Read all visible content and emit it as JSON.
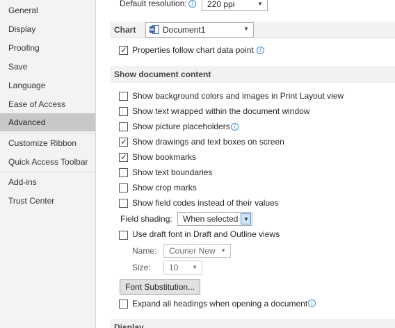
{
  "sidebar": {
    "items": [
      {
        "label": "General"
      },
      {
        "label": "Display"
      },
      {
        "label": "Proofing"
      },
      {
        "label": "Save"
      },
      {
        "label": "Language"
      },
      {
        "label": "Ease of Access"
      },
      {
        "label": "Advanced",
        "active": true
      },
      {
        "label": "Customize Ribbon"
      },
      {
        "label": "Quick Access Toolbar"
      },
      {
        "label": "Add-ins"
      },
      {
        "label": "Trust Center"
      }
    ]
  },
  "image_size": {
    "label": "Default resolution:",
    "value": "220 ppi"
  },
  "chart": {
    "title": "Chart",
    "document": "Document1",
    "properties_follow": {
      "label": "Properties follow chart data point",
      "checked": true
    }
  },
  "show_document_content": {
    "title": "Show document content",
    "options": [
      {
        "label": "Show background colors and images in Print Layout view",
        "checked": false
      },
      {
        "label": "Show text wrapped within the document window",
        "checked": false
      },
      {
        "label": "Show picture placeholders",
        "checked": false
      },
      {
        "label": "Show drawings and text boxes on screen",
        "checked": true
      },
      {
        "label": "Show bookmarks",
        "checked": true
      },
      {
        "label": "Show text boundaries",
        "checked": false
      },
      {
        "label": "Show crop marks",
        "checked": false
      },
      {
        "label": "Show field codes instead of their values",
        "checked": false
      }
    ],
    "field_shading": {
      "label": "Field shading:",
      "value": "When selected"
    },
    "draft_font": {
      "label": "Use draft font in Draft and Outline views",
      "checked": false
    },
    "name": {
      "label": "Name:",
      "value": "Courier New"
    },
    "size": {
      "label": "Size:",
      "value": "10"
    },
    "font_substitution": "Font Substitution...",
    "expand_headings": {
      "label": "Expand all headings when opening a document",
      "checked": false
    }
  },
  "display": {
    "title": "Display"
  },
  "icons": {
    "check": "✓",
    "info": "i",
    "dropdown": "▼"
  },
  "colors": {
    "active_sidebar": "#c8c8c8",
    "info_blue": "#3b8ad8",
    "word_blue": "#2b579a"
  }
}
